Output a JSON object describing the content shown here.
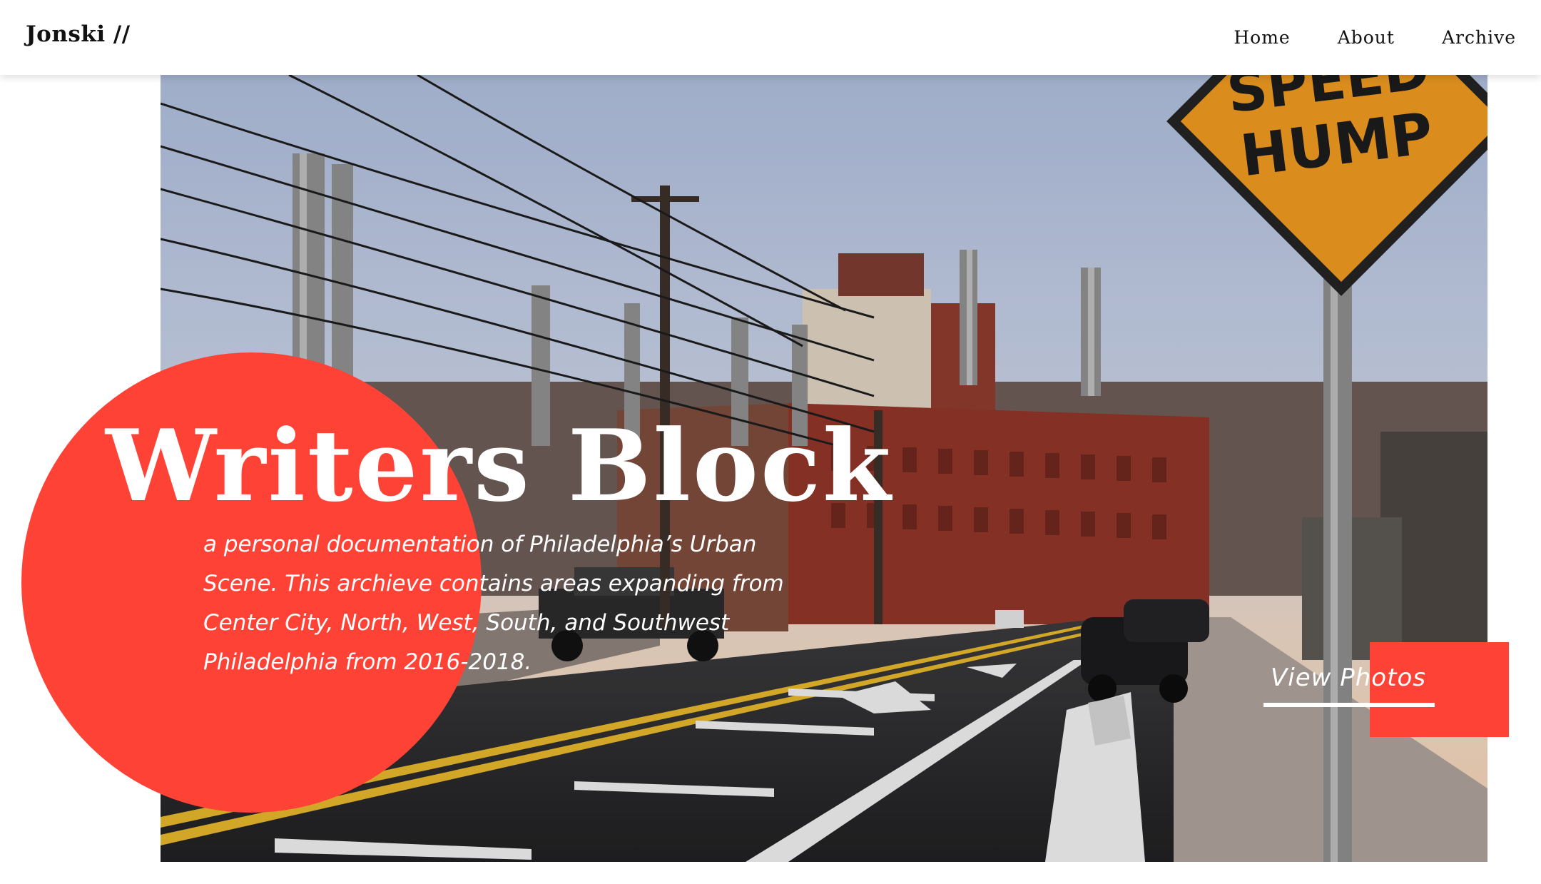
{
  "header": {
    "logo": "Jonski //",
    "nav": [
      "Home",
      "About",
      "Archive"
    ]
  },
  "hero": {
    "title": "Writers Block",
    "description": "a personal documentation of Philadelphia’s Urban Scene. This archieve contains areas expanding from Center City, North, West, South, and Southwest Philadelphia from 2016-2018.",
    "cta_label": "View Photos",
    "photo_sign_text": [
      "SPEED",
      "HUMP"
    ]
  },
  "colors": {
    "accent": "#ff4236",
    "header_bg": "#ffffff",
    "text_dark": "#111111",
    "text_light": "#ffffff"
  }
}
